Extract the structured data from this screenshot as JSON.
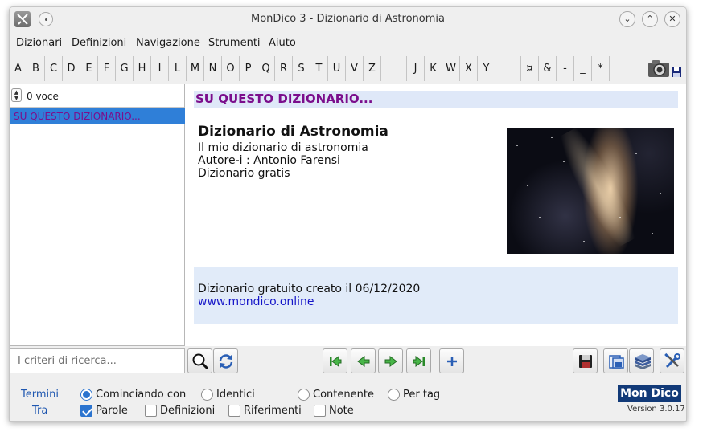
{
  "window": {
    "title": "MonDico 3 - Dizionario di Astronomia"
  },
  "menu": [
    "Dizionari",
    "Definizioni",
    "Navigazione",
    "Strumenti",
    "Aiuto"
  ],
  "alphabet": [
    "A",
    "B",
    "C",
    "D",
    "E",
    "F",
    "G",
    "H",
    "I",
    "L",
    "M",
    "N",
    "O",
    "P",
    "Q",
    "R",
    "S",
    "T",
    "U",
    "V",
    "Z",
    "",
    "J",
    "K",
    "W",
    "X",
    "Y",
    "",
    "¤",
    "&",
    "-",
    "_",
    "*"
  ],
  "list": {
    "count": "0 voce",
    "items": [
      "SU QUESTO DIZIONARIO..."
    ]
  },
  "content": {
    "section_title": "SU QUESTO DIZIONARIO...",
    "dict_title": "Dizionario di Astronomia",
    "lines": [
      "Il mio dizionario di astronomia",
      "Autore-i : Antonio Farensi",
      "Dizionario gratis"
    ],
    "info_text": "Dizionario gratuito creato il 06/12/2020",
    "info_link": "www.mondico.online",
    "image_icon": "galaxy-photo"
  },
  "search": {
    "placeholder": "I criteri di ricerca..."
  },
  "options": {
    "termini_label": "Termini",
    "tra_label": "Tra",
    "radios": [
      "Cominciando con",
      "Identici",
      "Contenente",
      "Per tag"
    ],
    "checks": [
      "Parole",
      "Definizioni",
      "Riferimenti",
      "Note"
    ]
  },
  "brand": {
    "logo": "Mon Dico",
    "version": "Version 3.0.17"
  },
  "colors": {
    "accent": "#2b74cf",
    "selection": "#2f7fd8",
    "heading": "#7b0e8c",
    "link": "#1515c8",
    "logo_bg": "#123a78"
  }
}
